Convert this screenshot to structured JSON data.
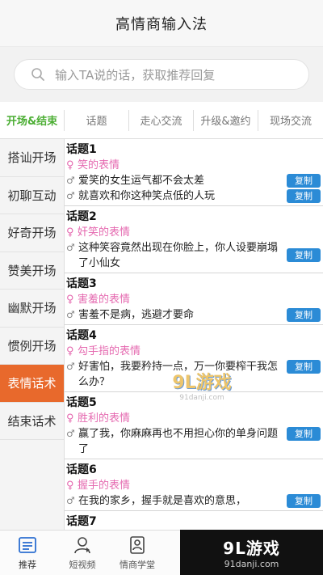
{
  "header": {
    "title": "高情商输入法"
  },
  "search": {
    "placeholder": "输入TA说的话，获取推荐回复"
  },
  "tabs": [
    {
      "label": "开场&结束",
      "active": true
    },
    {
      "label": "话题",
      "active": false
    },
    {
      "label": "走心交流",
      "active": false
    },
    {
      "label": "升级&邀约",
      "active": false
    },
    {
      "label": "现场交流",
      "active": false
    }
  ],
  "sidebar": [
    {
      "label": "搭讪开场"
    },
    {
      "label": "初聊互动"
    },
    {
      "label": "好奇开场"
    },
    {
      "label": "赞美开场"
    },
    {
      "label": "幽默开场"
    },
    {
      "label": "惯例开场"
    },
    {
      "label": "表情话术",
      "active": true
    },
    {
      "label": "结束话术"
    }
  ],
  "copy_label": "复制",
  "topics": [
    {
      "title": "话题1",
      "female": "笑的表情",
      "replies": [
        "爱笑的女生运气都不会太差",
        "就喜欢和你这种笑点低的人玩"
      ]
    },
    {
      "title": "话题2",
      "female": "奸笑的表情",
      "replies": [
        "这种笑容竟然出现在你脸上，你人设要崩塌了小仙女"
      ]
    },
    {
      "title": "话题3",
      "female": "害羞的表情",
      "replies": [
        "害羞不是病，逃避才要命"
      ]
    },
    {
      "title": "话题4",
      "female": "勾手指的表情",
      "replies": [
        "好害怕，我要矜持一点，万一你要榨干我怎么办？"
      ]
    },
    {
      "title": "话题5",
      "female": "胜利的表情",
      "replies": [
        "赢了我，你麻麻再也不用担心你的单身问题了"
      ]
    },
    {
      "title": "话题6",
      "female": "握手的表情",
      "replies": [
        "在我的家乡，握手就是喜欢的意思，"
      ]
    },
    {
      "title": "话题7",
      "female": "",
      "replies": []
    }
  ],
  "tabbar": [
    {
      "label": "推荐",
      "icon": "recommend-icon"
    },
    {
      "label": "短视频",
      "icon": "short-video-icon"
    },
    {
      "label": "情商学堂",
      "icon": "eq-school-icon"
    }
  ],
  "watermark": {
    "brand": "9L游戏",
    "url": "91danji.com"
  },
  "center_watermark": {
    "brand": "9L游戏",
    "url": "91danji.com"
  },
  "colors": {
    "accent_active_side": "#e8692c",
    "active_tab": "#4cae34",
    "copy_btn": "#2b8bd6",
    "female_text": "#e56ab0"
  }
}
